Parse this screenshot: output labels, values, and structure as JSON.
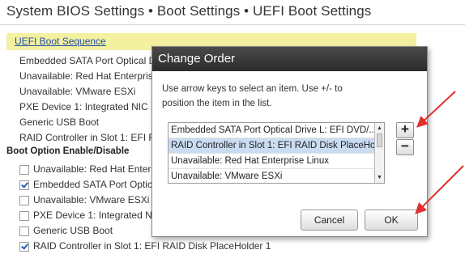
{
  "page": {
    "title": "System BIOS Settings • Boot Settings • UEFI Boot Settings"
  },
  "uefi_section": {
    "link_label": "UEFI Boot Sequence",
    "items": [
      "Embedded SATA Port Optical D",
      "Unavailable: Red Hat Enterprise",
      "Unavailable: VMware ESXi",
      "PXE Device 1: Integrated NIC 1",
      "Generic USB Boot",
      "RAID Controller in Slot 1: EFI RA"
    ]
  },
  "boot_options": {
    "heading": "Boot Option Enable/Disable",
    "items": [
      {
        "label": "Unavailable: Red Hat Enterpr",
        "checked": false
      },
      {
        "label": "Embedded SATA Port Optica",
        "checked": true
      },
      {
        "label": "Unavailable: VMware ESXi",
        "checked": false
      },
      {
        "label": "PXE Device 1: Integrated NIC",
        "checked": false
      },
      {
        "label": "Generic USB Boot",
        "checked": false
      },
      {
        "label": "RAID Controller in Slot 1: EFI RAID Disk PlaceHolder 1",
        "checked": true
      }
    ]
  },
  "dialog": {
    "title": "Change Order",
    "instructions": "Use arrow keys to select an item. Use +/- to position the item in the list.",
    "list_items": [
      "Embedded SATA Port Optical Drive L: EFI DVD/...",
      "RAID Controller in Slot 1: EFI RAID Disk PlaceHol...",
      "Unavailable: Red Hat Enterprise Linux",
      "Unavailable: VMware ESXi"
    ],
    "selected_index": 1,
    "plus_label": "+",
    "minus_label": "−",
    "cancel_label": "Cancel",
    "ok_label": "OK",
    "scroll_up": "▲",
    "scroll_down": "▼"
  },
  "colors": {
    "section_bar": "#f3f0a0",
    "link": "#1f4fa8",
    "dialog_header": "#333333",
    "selection": "#c9dcf2",
    "annotation_arrow": "#e03030"
  }
}
